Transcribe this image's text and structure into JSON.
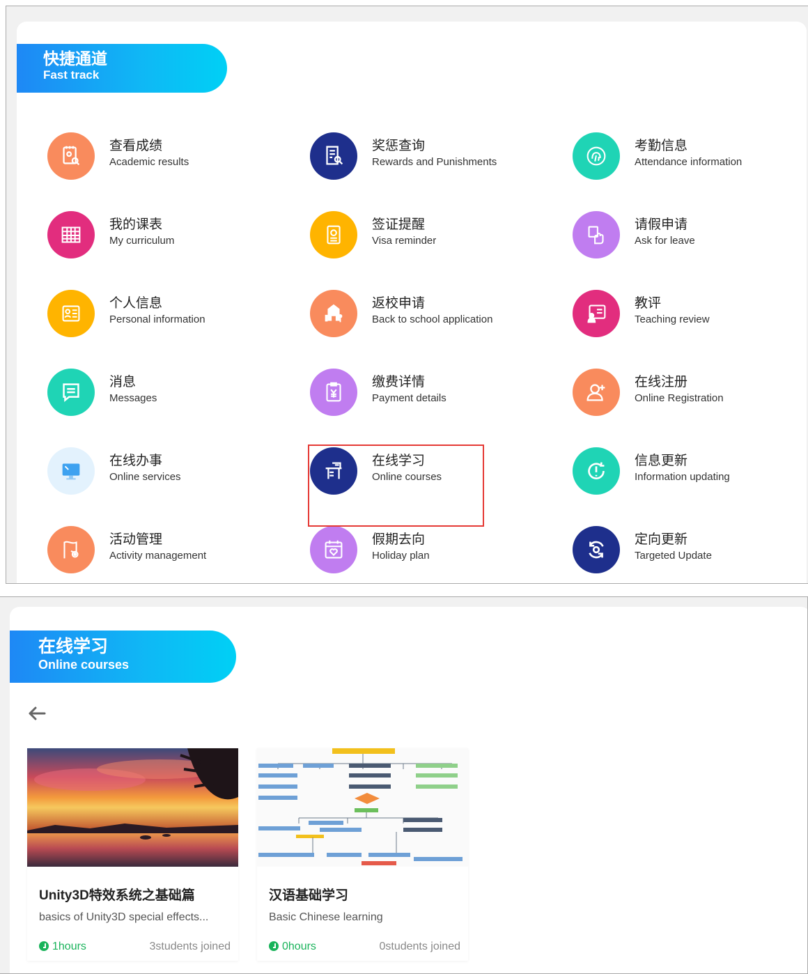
{
  "fast_track": {
    "title_cn": "快捷通道",
    "title_en": "Fast track",
    "items": [
      {
        "cn": "查看成绩",
        "en": "Academic results",
        "icon": "report-search-icon",
        "color": "#f98b5d"
      },
      {
        "cn": "奖惩查询",
        "en": "Rewards and Punishments",
        "icon": "document-search-icon",
        "color": "#1e2f8c"
      },
      {
        "cn": "考勤信息",
        "en": "Attendance information",
        "icon": "fingerprint-icon",
        "color": "#1fd4b5"
      },
      {
        "cn": "我的课表",
        "en": "My curriculum",
        "icon": "calendar-table-icon",
        "color": "#e22d7e"
      },
      {
        "cn": "签证提醒",
        "en": "Visa reminder",
        "icon": "passport-icon",
        "color": "#ffb400"
      },
      {
        "cn": "请假申请",
        "en": "Ask for leave",
        "icon": "hand-icon",
        "color": "#c07df0"
      },
      {
        "cn": "个人信息",
        "en": "Personal information",
        "icon": "id-card-icon",
        "color": "#ffb400"
      },
      {
        "cn": "返校申请",
        "en": "Back to school application",
        "icon": "school-building-icon",
        "color": "#f98b5d"
      },
      {
        "cn": "教评",
        "en": "Teaching review",
        "icon": "teacher-board-icon",
        "color": "#e22d7e"
      },
      {
        "cn": "消息",
        "en": "Messages",
        "icon": "message-icon",
        "color": "#1fd4b5"
      },
      {
        "cn": "缴费详情",
        "en": "Payment details",
        "icon": "payment-clipboard-icon",
        "color": "#c07df0"
      },
      {
        "cn": "在线注册",
        "en": "Online Registration",
        "icon": "add-user-icon",
        "color": "#f98b5d"
      },
      {
        "cn": "在线办事",
        "en": "Online services",
        "icon": "monitor-icon",
        "color": "#e3f2fd"
      },
      {
        "cn": "在线学习",
        "en": "Online courses",
        "icon": "desk-icon",
        "color": "#1e2f8c"
      },
      {
        "cn": "信息更新",
        "en": "Information updating",
        "icon": "info-refresh-icon",
        "color": "#1fd4b5"
      },
      {
        "cn": "活动管理",
        "en": "Activity management",
        "icon": "flag-gear-icon",
        "color": "#f98b5d"
      },
      {
        "cn": "假期去向",
        "en": "Holiday plan",
        "icon": "calendar-heart-icon",
        "color": "#c07df0"
      },
      {
        "cn": "定向更新",
        "en": "Targeted Update",
        "icon": "sync-icon",
        "color": "#1e2f8c"
      }
    ]
  },
  "online_courses": {
    "title_cn": "在线学习",
    "title_en": "Online courses",
    "courses": [
      {
        "title": "Unity3D特效系统之基础篇",
        "desc": "basics of Unity3D special effects...",
        "hours": "1hours",
        "joined": "3students joined"
      },
      {
        "title": "汉语基础学习",
        "desc": "Basic Chinese learning",
        "hours": "0hours",
        "joined": "0students joined"
      }
    ]
  }
}
